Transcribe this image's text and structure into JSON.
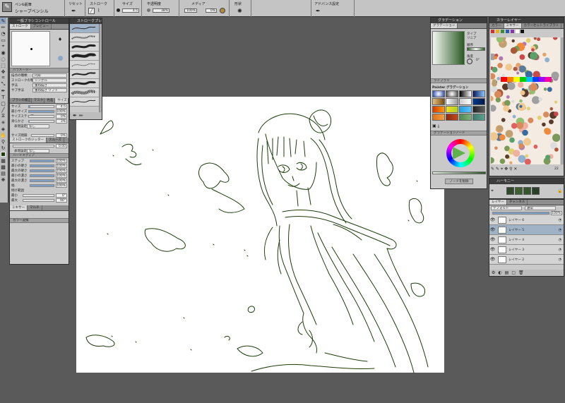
{
  "app": {
    "name": "Painter"
  },
  "top_toolbar": {
    "brush_category": "ペン&鉛筆",
    "brush_variant": "シャープペンシル",
    "preset_label": "リセット",
    "stroke_label": "ストローク",
    "size_label": "サイズ",
    "size_value": "4.5",
    "opacity_label": "不透明度",
    "opacity_value": "38%",
    "media_label": "メディア",
    "grain_value": "100%",
    "grain2_value": "0%",
    "shape_label": "形状",
    "advanced_label": "アドバンス設定"
  },
  "brush_control_panel": {
    "title": "一般ブラシコントロール",
    "tabs": [
      "ストローク",
      "プレビュー"
    ],
    "params_title": "パラメーター",
    "rows": [
      {
        "label": "描点の種類",
        "value": "円形"
      },
      {
        "label": "ストロークの種類",
        "value": "シングル"
      },
      {
        "label": "手法",
        "value": "重ね描き"
      },
      {
        "label": "サブ手法",
        "value": "重ね描き ソフト"
      }
    ],
    "sub_tabs": [
      "ブラシの補正",
      "マスク",
      "色差",
      "サイズ"
    ],
    "size_rows": [
      {
        "label": "サイズ",
        "value": "4.5",
        "fill": 0.05
      },
      {
        "label": "最小サイズ",
        "value": "100%",
        "fill": 1.0
      },
      {
        "label": "サイズステップ",
        "value": "0%",
        "fill": 0.0
      },
      {
        "label": "滑らかさ",
        "value": "3%",
        "fill": 0.03
      }
    ],
    "expression_label": "表現設定",
    "expression_value": "なし",
    "size_interval_label": "サイズ間隔",
    "size_interval_value": "0%",
    "stroke_jitter_title": "ストロークのジッター",
    "smoothing_label": "スムーズ",
    "jitter_value": "0.00",
    "jitter_expr_value": "なし",
    "hard_media_title": "ハードメディア",
    "hard_media_rows": [
      {
        "label": "ステップ",
        "value": "100%"
      },
      {
        "label": "最小の硬さ",
        "value": "100%"
      },
      {
        "label": "最大の硬さ",
        "value": "100%"
      },
      {
        "label": "最小の濃さ",
        "value": "100%"
      },
      {
        "label": "最大の濃さ",
        "value": "100%"
      },
      {
        "label": "幅",
        "value": "100%"
      }
    ],
    "angle_title": "傾け範囲",
    "angle_rows": [
      {
        "label": "最小",
        "value": "0°"
      },
      {
        "label": "最大",
        "value": "90°"
      }
    ],
    "mixer_title": "ミキサー",
    "mixer_tab2": "マルチ",
    "color_var_title": "カラー変換"
  },
  "variant_palette": {
    "title": "ストロークプレビュー"
  },
  "gradient_panel": {
    "title": "グラデーション",
    "subtitle": "グラデーション",
    "type_label": "タイプ",
    "type_value": "リニア",
    "order_label": "順序",
    "angle_label": "角度",
    "angle_value": "0°",
    "library_label": "ライブラリ",
    "library_title": "Painter グラデーション",
    "nodes_label": "グラデーションノード",
    "remove_node_label": "ノードを削除"
  },
  "color_panel": {
    "title": "カラーレイヤー",
    "tabs": [
      "カラー",
      "ミキサー",
      "カラーセットライブラリ"
    ],
    "hex_value": "22"
  },
  "navigator": {
    "title": "ハーモニー"
  },
  "layers_panel": {
    "title": "レイヤー",
    "tab2": "チャンネル",
    "blend_mode": "デフォルト",
    "composite": "通常",
    "opacity": "100%",
    "layers": [
      {
        "name": "レイヤー 6"
      },
      {
        "name": "レイヤー 5"
      },
      {
        "name": "レイヤー 4"
      },
      {
        "name": "レイヤー 3"
      },
      {
        "name": "レイヤー 2"
      }
    ]
  },
  "colors": {
    "accent_stroke": "#1d3d0a",
    "panel_bg": "#c9c9c9",
    "workspace_bg": "#5a5a5a",
    "gradient_start": "#f2f7f0",
    "gradient_end": "#2b5a24"
  },
  "icons": [
    "brush-icon",
    "pencil-icon",
    "eraser-icon",
    "dropper-icon",
    "text-tool-icon",
    "shape-icon",
    "hand-icon",
    "zoom-icon",
    "color-wheel-icon",
    "eye-icon",
    "new-layer-icon",
    "trash-icon"
  ]
}
